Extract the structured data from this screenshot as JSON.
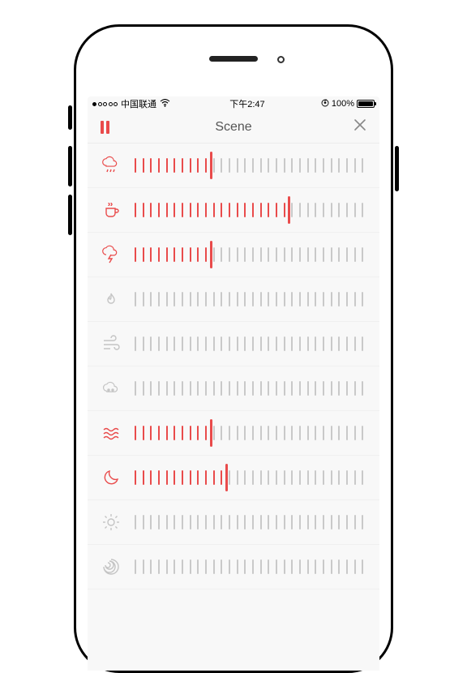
{
  "statusbar": {
    "signal_filled": 1,
    "signal_total": 5,
    "carrier": "中国联通",
    "time": "下午2:47",
    "battery_pct": "100%"
  },
  "header": {
    "title": "Scene"
  },
  "slider": {
    "segments": 30
  },
  "sounds": [
    {
      "icon": "rain",
      "active": true,
      "value": 10
    },
    {
      "icon": "coffee",
      "active": true,
      "value": 20
    },
    {
      "icon": "thunder",
      "active": true,
      "value": 10
    },
    {
      "icon": "fire",
      "active": false,
      "value": 0
    },
    {
      "icon": "wind",
      "active": false,
      "value": 0
    },
    {
      "icon": "cloud",
      "active": false,
      "value": 0
    },
    {
      "icon": "waves",
      "active": true,
      "value": 10
    },
    {
      "icon": "moon",
      "active": true,
      "value": 12
    },
    {
      "icon": "sun",
      "active": false,
      "value": 0
    },
    {
      "icon": "vortex",
      "active": false,
      "value": 0
    }
  ],
  "colors": {
    "accent": "#e94b4b",
    "inactive": "#c4c4c4",
    "tick_off": "#c9c9c9"
  }
}
